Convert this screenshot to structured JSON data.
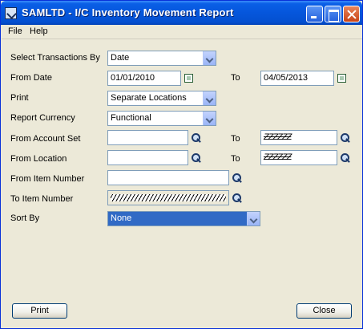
{
  "window": {
    "title": "SAMLTD - I/C Inventory Movement Report"
  },
  "menu": {
    "file": "File",
    "help": "Help"
  },
  "form": {
    "select_transactions_by": {
      "label": "Select Transactions By",
      "value": "Date"
    },
    "from_date": {
      "label": "From Date",
      "value": "01/01/2010"
    },
    "to_date": {
      "label": "To",
      "value": "04/05/2013"
    },
    "print": {
      "label": "Print",
      "value": "Separate Locations"
    },
    "report_currency": {
      "label": "Report Currency",
      "value": "Functional"
    },
    "from_account_set": {
      "label": "From Account Set",
      "value": ""
    },
    "to_account_set": {
      "label": "To",
      "value": "ZZZZZZ"
    },
    "from_location": {
      "label": "From Location",
      "value": ""
    },
    "to_location": {
      "label": "To",
      "value": "ZZZZZZ"
    },
    "from_item_number": {
      "label": "From Item Number",
      "value": ""
    },
    "to_item_number": {
      "label": "To Item Number",
      "value": ""
    },
    "sort_by": {
      "label": "Sort By",
      "value": "None"
    }
  },
  "buttons": {
    "print": "Print",
    "close": "Close"
  }
}
